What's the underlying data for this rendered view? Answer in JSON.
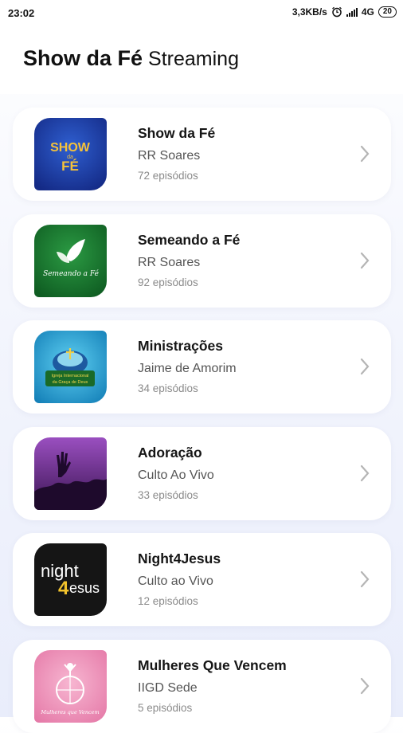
{
  "status": {
    "time": "23:02",
    "speed": "3,3KB/s",
    "network": "4G",
    "battery": "20"
  },
  "header": {
    "title_bold": "Show da Fé",
    "title_light": "Streaming"
  },
  "items": [
    {
      "title": "Show da Fé",
      "author": "RR Soares",
      "episodes": "72 episódios",
      "thumb_text": "SHOW da FÉ",
      "thumb_color": "#1c3c9c"
    },
    {
      "title": "Semeando a Fé",
      "author": "RR Soares",
      "episodes": "92 episódios",
      "thumb_text": "Semeando a Fé",
      "thumb_color": "#17752f"
    },
    {
      "title": "Ministrações",
      "author": "Jaime de Amorim",
      "episodes": "34 episódios",
      "thumb_text": "Igreja Internacional da Graça de Deus",
      "thumb_color": "#23a8d9"
    },
    {
      "title": "Adoração",
      "author": "Culto Ao Vivo",
      "episodes": "33 episódios",
      "thumb_color": "#6a2a86"
    },
    {
      "title": "Night4Jesus",
      "author": "Culto ao Vivo",
      "episodes": "12 episódios",
      "thumb_text": "night 4esus",
      "thumb_color": "#141414"
    },
    {
      "title": "Mulheres Que Vencem",
      "author": "IIGD Sede",
      "episodes": "5 episódios",
      "thumb_text": "Mulheres que Vencem",
      "thumb_color": "#ee8fb7"
    }
  ]
}
